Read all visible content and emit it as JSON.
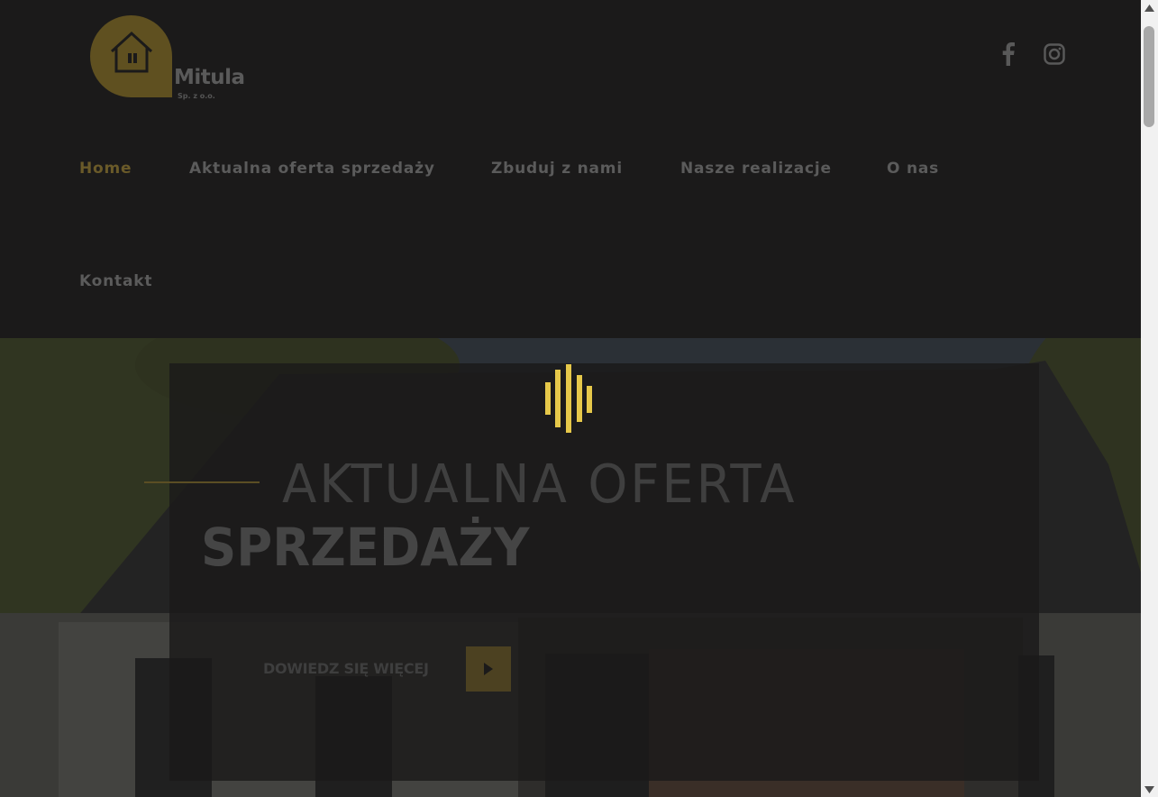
{
  "brand": {
    "name": "Mitula",
    "suffix": "Sp. z o.o.",
    "accent_color": "#6a5a29",
    "logo_color": "#5f5020"
  },
  "header": {
    "social": [
      {
        "icon": "facebook-icon"
      },
      {
        "icon": "instagram-icon"
      }
    ]
  },
  "nav": {
    "items": [
      {
        "label": "Home",
        "active": true
      },
      {
        "label": "Aktualna oferta sprzedaży"
      },
      {
        "label": "Zbuduj z nami"
      },
      {
        "label": "Nasze realizacje"
      },
      {
        "label": "O nas"
      },
      {
        "label": "Kontakt"
      }
    ]
  },
  "hero": {
    "title_line1": "AKTUALNA OFERTA",
    "title_line2": "SPRZEDAŻY",
    "cta_label": "DOWIEDZ SIĘ WIĘCEJ",
    "cta_icon": "play-icon",
    "loader_icon": "audio-bars-icon",
    "loader_color": "#e6c84a"
  },
  "scrollbar": {
    "up_icon": "arrow-up-icon",
    "down_icon": "arrow-down-icon"
  }
}
